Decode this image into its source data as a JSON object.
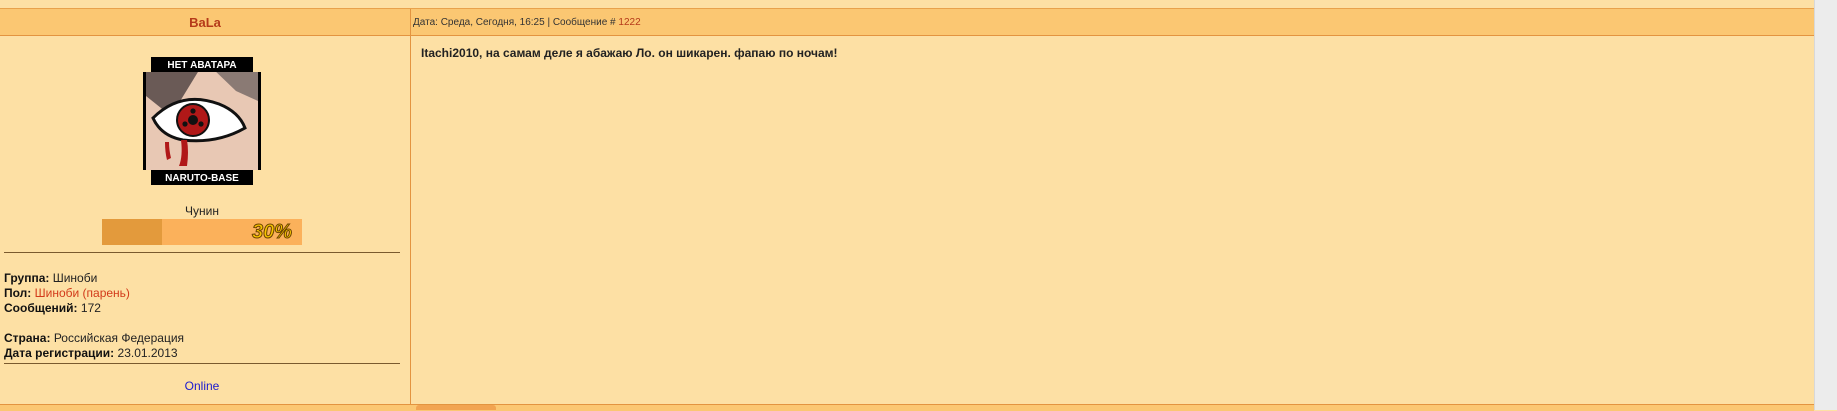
{
  "post": {
    "username": "BaLa",
    "header_prefix": "Дата: Среда, Сегодня, 16:25 | Сообщение # ",
    "message_number": "1222",
    "message_text": "Itachi2010, на самам деле я абажаю Ло. он шикарен. фапаю по ночам!"
  },
  "avatar": {
    "top_text": "НЕТ АВАТАРА",
    "bottom_text": "NARUTO-BASE"
  },
  "profile": {
    "rank": "Чунин",
    "reputation_percent_label": "30%",
    "reputation_fill_fraction": 0.3,
    "group_label": "Группа:",
    "group_value": "Шиноби",
    "gender_label": "Пол:",
    "gender_value": "Шиноби (парень)",
    "posts_label": "Сообщений:",
    "posts_value": "172",
    "country_label": "Страна:",
    "country_value": "Российская Федерация",
    "registered_label": "Дата регистрации:",
    "registered_value": "23.01.2013",
    "status": "Online"
  },
  "colors": {
    "background": "#fde0a4",
    "header": "#fbc772",
    "border": "#e39440",
    "username": "#b53a1a",
    "link_red": "#d23a1a",
    "online": "#1a1ad0"
  }
}
